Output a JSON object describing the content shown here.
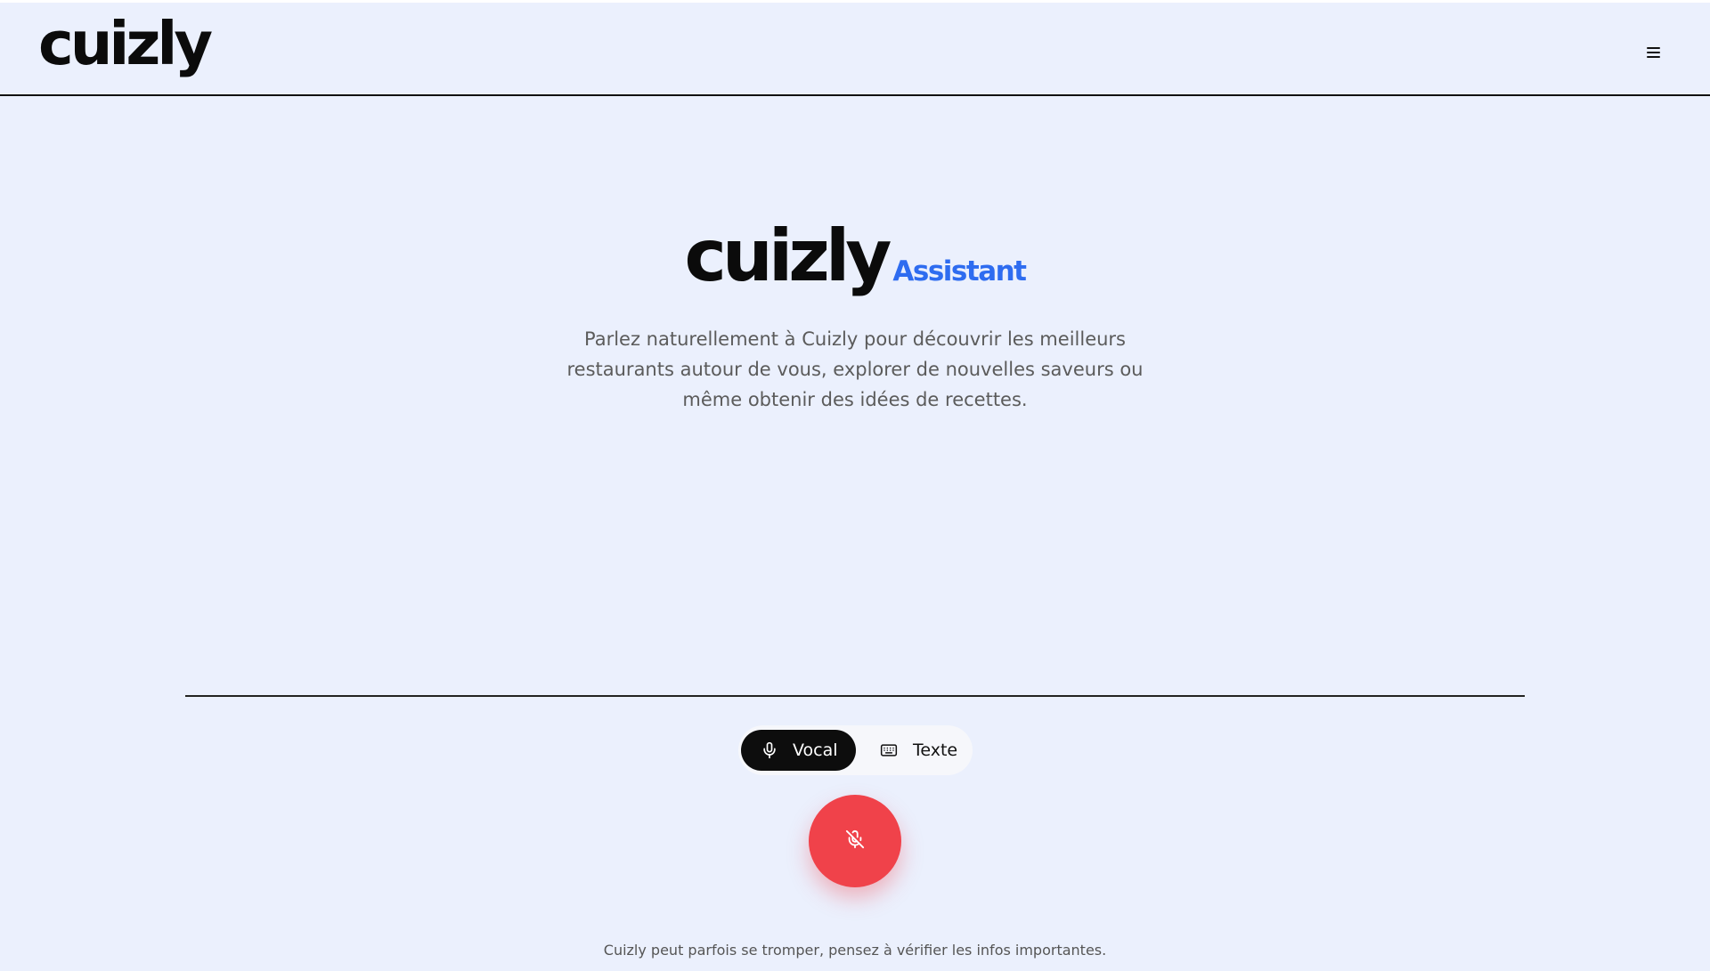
{
  "header": {
    "brand": "cuizly",
    "menu_icon": "hamburger-menu-icon"
  },
  "hero": {
    "brand": "cuizly",
    "subtitle": "Assistant",
    "description": "Parlez naturellement à Cuizly pour découvrir les meilleurs restaurants autour de vous, explorer de nouvelles saveurs ou même obtenir des idées de recettes."
  },
  "mode_toggle": {
    "vocal": {
      "label": "Vocal",
      "icon": "microphone-icon",
      "selected": true
    },
    "texte": {
      "label": "Texte",
      "icon": "keyboard-icon",
      "selected": false
    }
  },
  "mic_button": {
    "icon": "microphone-off-icon",
    "color": "#f0424a"
  },
  "footer": {
    "disclaimer": "Cuizly peut parfois se tromper, pensez à vérifier les infos importantes."
  },
  "colors": {
    "background": "#ebf0fd",
    "accent": "#2e6cf0",
    "primary_dark": "#0d0d0d",
    "mic_red": "#f0424a"
  }
}
